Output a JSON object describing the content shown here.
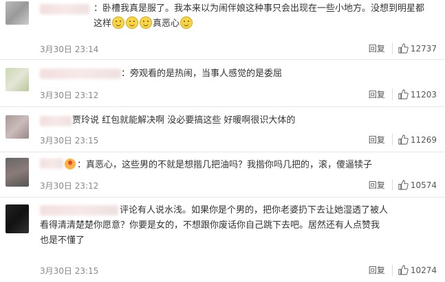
{
  "comments": [
    {
      "text": "卧槽我真是服了。我本来以为闹伴娘这种事只会出现在一些小地方。没想到明星都这样",
      "text_after_emoji": "真恶心",
      "timestamp": "3月30日 23:14",
      "reply_label": "回复",
      "likes": "12737",
      "emojis": [
        "grin-emoji",
        "grin-emoji",
        "grin-emoji"
      ],
      "trailing_emoji": "smile-emoji"
    },
    {
      "text": "旁观看的是热闹，当事人感觉的是委屈",
      "timestamp": "3月30日 23:12",
      "reply_label": "回复",
      "likes": "11203"
    },
    {
      "text": "贾玲说 红包就能解决啊 没必要搞这些 好暖啊很识大体的",
      "timestamp": "3月30日 23:15",
      "reply_label": "回复",
      "likes": "11269"
    },
    {
      "text": "真恶心，这些男的不就是想揩几把油吗？我揩你吗几把的，滚，傻逼犊子",
      "timestamp": "3月30日 23:12",
      "reply_label": "回复",
      "likes": "10574"
    },
    {
      "text_line1": "评论有人说水浅。如果你是个男的，把你老婆扔下去让她湿透了被人",
      "text_line2": "看得清清楚楚你愿意？你要是女的，不想跟你废话你自己跳下去吧。居然还有人点赞我",
      "text_line3": "也是不懂了",
      "timestamp": "3月30日 23:15",
      "reply_label": "回复",
      "likes": "10274"
    }
  ]
}
